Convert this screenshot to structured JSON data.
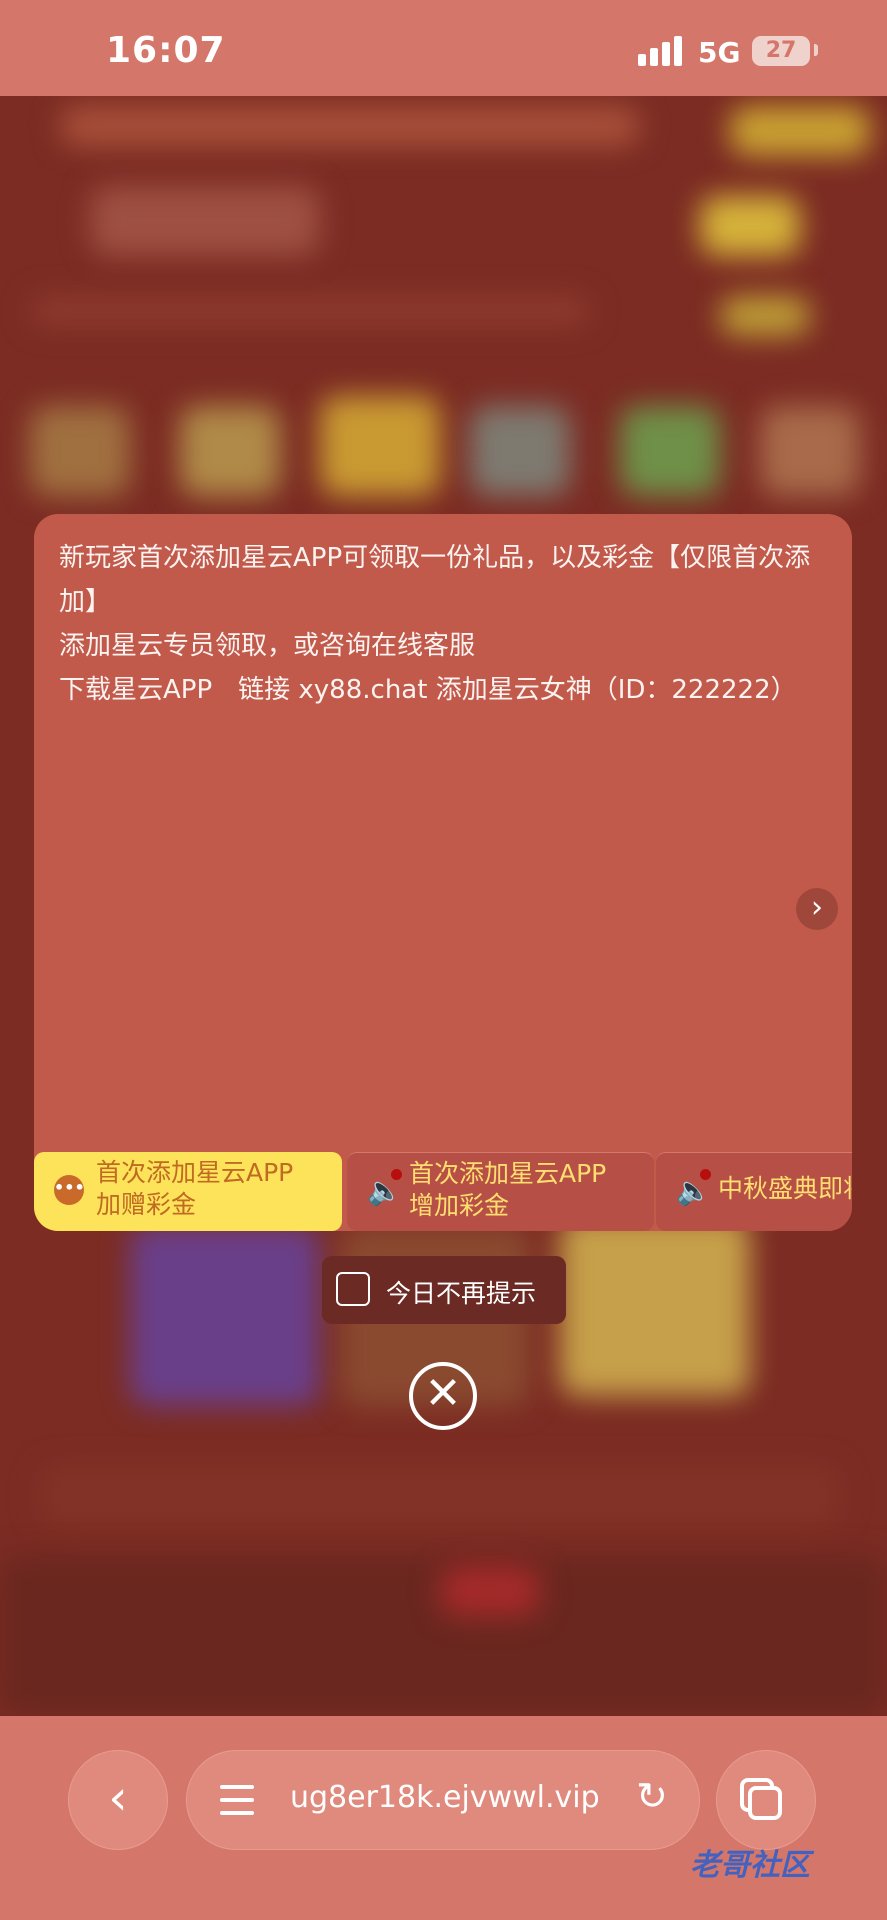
{
  "status_bar": {
    "time": "16:07",
    "network": "5G",
    "battery": "27"
  },
  "popup": {
    "lines": [
      "新玩家首次添加星云APP可领取一份礼品，以及彩金【仅限首次添加】",
      "添加星云专员领取，或咨询在线客服",
      "下载星云APP　链接 xy88.chat  添加星云女神（ID：222222）"
    ],
    "tabs": [
      {
        "line1": "首次添加星云APP",
        "line2": "加赠彩金"
      },
      {
        "line1": "首次添加星云APP",
        "line2": "增加彩金"
      },
      {
        "line1": "中秋盛典即将"
      }
    ]
  },
  "no_remind": {
    "label": "今日不再提示"
  },
  "browser": {
    "url": "ug8er18k.ejvwwl.vip"
  },
  "watermark": "老哥社区"
}
